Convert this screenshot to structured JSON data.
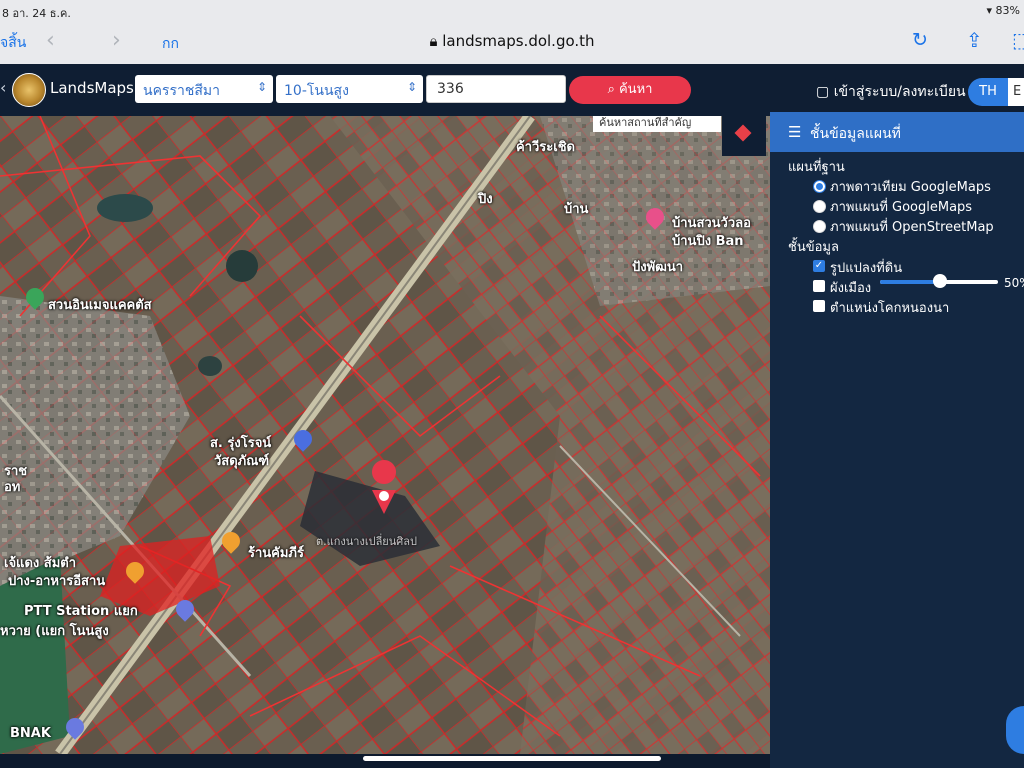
{
  "status": {
    "time": "8  อา. 24 ธ.ค.",
    "battery": "83%"
  },
  "browser": {
    "done_label": "จสิ้น",
    "text_size_label": "กก",
    "url": "landsmaps.dol.go.th"
  },
  "app": {
    "brand": "LandsMaps",
    "province_select": "นครราชสีมา",
    "district_select": "10-โนนสูง",
    "parcel_input": "336",
    "search_label": "ค้นหา",
    "login_label": "เข้าสู่ระบบ/ลงทะเบียน",
    "lang_th": "TH",
    "lang_en": "E"
  },
  "map": {
    "find_place_placeholder": "ค้นหาสถานที่สำคัญ",
    "labels": {
      "a": "ค้าวีระเชิด",
      "b": "ปิง",
      "c": "บ้าน",
      "d": "บ้านสวนวัวลอ",
      "e": "บ้านปิง Ban",
      "f": "ปังพัฒนา",
      "g": "สวนอินเมจแคคตัส",
      "h": "ส. รุ่งโรจน์",
      "i": "วัสดุภัณฑ์",
      "j": "ราช",
      "k": "อท",
      "l": "เจ้แดง ส้มตำ",
      "m": "ปาง-อาหารอีสาน",
      "n": "ร้านคัมภีร์",
      "o": "PTT Station แยก",
      "p": "หวาย (แยก โนนสูง",
      "q": "BNAK",
      "r": "ต.แกงนางเปลี่ยนศิลป"
    }
  },
  "panel": {
    "title": "ชั้นข้อมูลแผนที่",
    "basemap_label": "แผนที่ฐาน",
    "basemaps": [
      {
        "label": "ภาพดาวเทียม GoogleMaps",
        "selected": true
      },
      {
        "label": "ภาพแผนที่ GoogleMaps",
        "selected": false
      },
      {
        "label": "ภาพแผนที่ OpenStreetMap",
        "selected": false
      }
    ],
    "layers_label": "ชั้นข้อมูล",
    "layers": [
      {
        "label": "รูปแปลงที่ดิน",
        "checked": true
      },
      {
        "label": "ผังเมือง",
        "checked": false
      },
      {
        "label": "ตำแหน่งโคกหนองนา",
        "checked": false
      }
    ],
    "opacity_percent": "50%"
  },
  "colors": {
    "accent": "#2e7de1",
    "search": "#e8374b",
    "parcel": "#e03030",
    "bg": "#0f1e33"
  }
}
